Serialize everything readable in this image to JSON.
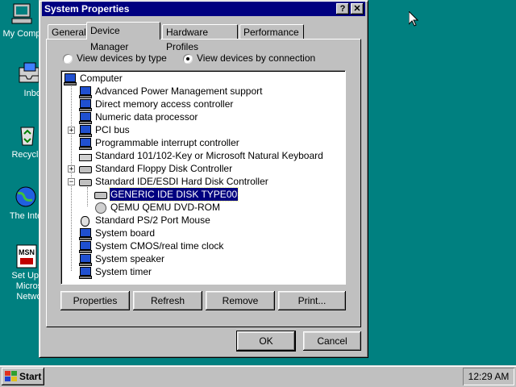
{
  "desktop": {
    "icons": [
      {
        "label": "My Comp",
        "icon": "my-computer-icon"
      },
      {
        "label": "Inbox",
        "icon": "inbox-icon"
      },
      {
        "label": "Recycle",
        "icon": "recycle-bin-icon"
      },
      {
        "label": "The Inte",
        "icon": "internet-explorer-icon"
      },
      {
        "label": "Set Up T\nMicros\nNetwo",
        "icon": "msn-icon"
      }
    ]
  },
  "window": {
    "title": "System Properties",
    "help_glyph": "?",
    "close_glyph": "✕",
    "tabs": [
      "General",
      "Device Manager",
      "Hardware Profiles",
      "Performance"
    ],
    "active_tab": "Device Manager",
    "view_by_type": "View devices by type",
    "view_by_connection": "View devices by connection",
    "selected_view": "connection",
    "tree": [
      {
        "label": "Computer",
        "level": 0,
        "icon": "computer-icon"
      },
      {
        "label": "Advanced Power Management support",
        "level": 1,
        "icon": "computer-icon"
      },
      {
        "label": "Direct memory access controller",
        "level": 1,
        "icon": "computer-icon"
      },
      {
        "label": "Numeric data processor",
        "level": 1,
        "icon": "computer-icon"
      },
      {
        "label": "PCI bus",
        "level": 1,
        "icon": "computer-icon",
        "expander": "+"
      },
      {
        "label": "Programmable interrupt controller",
        "level": 1,
        "icon": "computer-icon"
      },
      {
        "label": "Standard 101/102-Key or Microsoft Natural Keyboard",
        "level": 1,
        "icon": "keyboard-icon"
      },
      {
        "label": "Standard Floppy Disk Controller",
        "level": 1,
        "icon": "disk-controller-icon",
        "expander": "+"
      },
      {
        "label": "Standard IDE/ESDI Hard Disk Controller",
        "level": 1,
        "icon": "disk-controller-icon",
        "expander": "−"
      },
      {
        "label": "GENERIC IDE  DISK TYPE00",
        "level": 2,
        "icon": "hard-disk-icon",
        "selected": true
      },
      {
        "label": "QEMU QEMU DVD-ROM",
        "level": 2,
        "icon": "cd-rom-icon"
      },
      {
        "label": "Standard PS/2 Port Mouse",
        "level": 1,
        "icon": "mouse-icon"
      },
      {
        "label": "System board",
        "level": 1,
        "icon": "computer-icon"
      },
      {
        "label": "System CMOS/real time clock",
        "level": 1,
        "icon": "computer-icon"
      },
      {
        "label": "System speaker",
        "level": 1,
        "icon": "computer-icon"
      },
      {
        "label": "System timer",
        "level": 1,
        "icon": "computer-icon"
      }
    ],
    "buttons": {
      "properties": "Properties",
      "refresh": "Refresh",
      "remove": "Remove",
      "print": "Print...",
      "ok": "OK",
      "cancel": "Cancel"
    }
  },
  "taskbar": {
    "start_label": "Start",
    "clock": "12:29 AM"
  },
  "colors": {
    "desktop": "#008080",
    "titlebar": "#000080",
    "face": "#c0c0c0"
  }
}
